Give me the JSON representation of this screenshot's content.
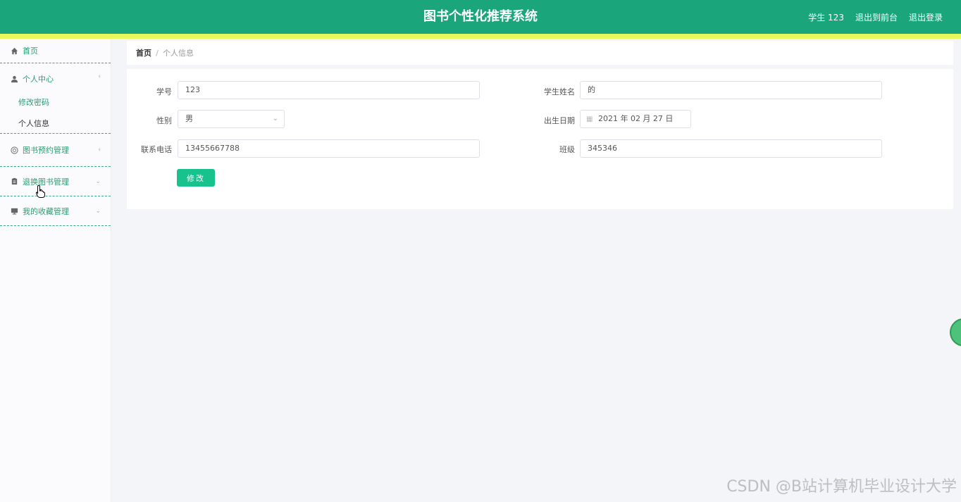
{
  "header": {
    "title": "图书个性化推荐系统",
    "user": "学生 123",
    "back_to_front": "退出到前台",
    "logout": "退出登录"
  },
  "sidebar": {
    "home": "首页",
    "personal_center": "个人中心",
    "change_password": "修改密码",
    "personal_info": "个人信息",
    "book_reservation": "图书预约管理",
    "return_book": "退换图书管理",
    "favorites": "我的收藏管理"
  },
  "breadcrumb": {
    "home": "首页",
    "separator": "/",
    "current": "个人信息"
  },
  "form": {
    "student_id_label": "学号",
    "student_id_value": "123",
    "student_name_label": "学生姓名",
    "student_name_value": "的",
    "gender_label": "性别",
    "gender_value": "男",
    "birth_label": "出生日期",
    "birth_value": "2021 年 02 月 27 日",
    "phone_label": "联系电话",
    "phone_value": "13455667788",
    "class_label": "班级",
    "class_value": "345346",
    "submit_label": "修改"
  },
  "watermark": "CSDN @B站计算机毕业设计大学",
  "colors": {
    "header_bg": "#1aa67a",
    "accent_stripe": "#e8f75a",
    "menu_text": "#2a9d6f",
    "button_bg": "#18c28c"
  }
}
